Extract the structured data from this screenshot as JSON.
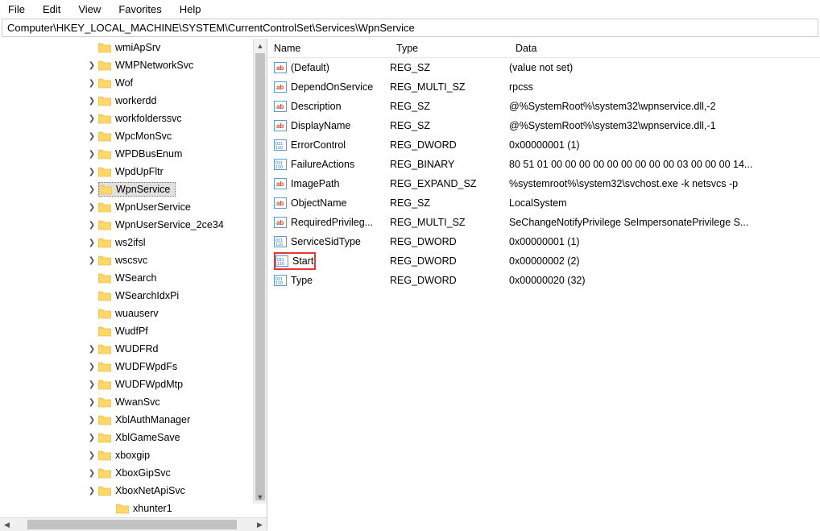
{
  "menu": {
    "file": "File",
    "edit": "Edit",
    "view": "View",
    "favorites": "Favorites",
    "help": "Help"
  },
  "address": "Computer\\HKEY_LOCAL_MACHINE\\SYSTEM\\CurrentControlSet\\Services\\WpnService",
  "tree": [
    {
      "label": "wmiApSrv",
      "expand": ""
    },
    {
      "label": "WMPNetworkSvc",
      "expand": ">"
    },
    {
      "label": "Wof",
      "expand": ">"
    },
    {
      "label": "workerdd",
      "expand": ">"
    },
    {
      "label": "workfolderssvc",
      "expand": ">"
    },
    {
      "label": "WpcMonSvc",
      "expand": ">"
    },
    {
      "label": "WPDBusEnum",
      "expand": ">"
    },
    {
      "label": "WpdUpFltr",
      "expand": ">"
    },
    {
      "label": "WpnService",
      "expand": ">",
      "selected": true
    },
    {
      "label": "WpnUserService",
      "expand": ">"
    },
    {
      "label": "WpnUserService_2ce34",
      "expand": ">"
    },
    {
      "label": "ws2ifsl",
      "expand": ">"
    },
    {
      "label": "wscsvc",
      "expand": ">"
    },
    {
      "label": "WSearch",
      "expand": ""
    },
    {
      "label": "WSearchIdxPi",
      "expand": ""
    },
    {
      "label": "wuauserv",
      "expand": ""
    },
    {
      "label": "WudfPf",
      "expand": ""
    },
    {
      "label": "WUDFRd",
      "expand": ">"
    },
    {
      "label": "WUDFWpdFs",
      "expand": ">"
    },
    {
      "label": "WUDFWpdMtp",
      "expand": ">"
    },
    {
      "label": "WwanSvc",
      "expand": ">"
    },
    {
      "label": "XblAuthManager",
      "expand": ">"
    },
    {
      "label": "XblGameSave",
      "expand": ">"
    },
    {
      "label": "xboxgip",
      "expand": ">"
    },
    {
      "label": "XboxGipSvc",
      "expand": ">"
    },
    {
      "label": "XboxNetApiSvc",
      "expand": ">"
    },
    {
      "label": "xhunter1",
      "expand": "",
      "depth": 2
    }
  ],
  "columns": {
    "name": "Name",
    "type": "Type",
    "data": "Data"
  },
  "values": [
    {
      "name": "(Default)",
      "type": "REG_SZ",
      "data": "(value not set)",
      "icon": "sz"
    },
    {
      "name": "DependOnService",
      "type": "REG_MULTI_SZ",
      "data": "rpcss",
      "icon": "sz"
    },
    {
      "name": "Description",
      "type": "REG_SZ",
      "data": "@%SystemRoot%\\system32\\wpnservice.dll,-2",
      "icon": "sz"
    },
    {
      "name": "DisplayName",
      "type": "REG_SZ",
      "data": "@%SystemRoot%\\system32\\wpnservice.dll,-1",
      "icon": "sz"
    },
    {
      "name": "ErrorControl",
      "type": "REG_DWORD",
      "data": "0x00000001 (1)",
      "icon": "bin"
    },
    {
      "name": "FailureActions",
      "type": "REG_BINARY",
      "data": "80 51 01 00 00 00 00 00 00 00 00 00 03 00 00 00 14...",
      "icon": "bin"
    },
    {
      "name": "ImagePath",
      "type": "REG_EXPAND_SZ",
      "data": "%systemroot%\\system32\\svchost.exe -k netsvcs -p",
      "icon": "sz"
    },
    {
      "name": "ObjectName",
      "type": "REG_SZ",
      "data": "LocalSystem",
      "icon": "sz"
    },
    {
      "name": "RequiredPrivileg...",
      "type": "REG_MULTI_SZ",
      "data": "SeChangeNotifyPrivilege SeImpersonatePrivilege S...",
      "icon": "sz"
    },
    {
      "name": "ServiceSidType",
      "type": "REG_DWORD",
      "data": "0x00000001 (1)",
      "icon": "bin"
    },
    {
      "name": "Start",
      "type": "REG_DWORD",
      "data": "0x00000002 (2)",
      "icon": "bin",
      "selected": true
    },
    {
      "name": "Type",
      "type": "REG_DWORD",
      "data": "0x00000020 (32)",
      "icon": "bin"
    }
  ]
}
